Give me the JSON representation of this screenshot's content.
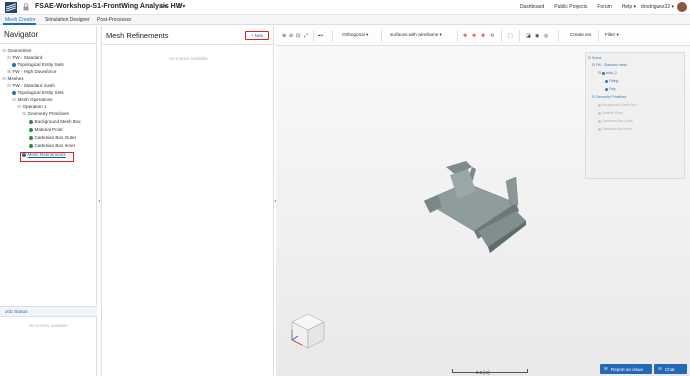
{
  "app": {
    "project_title": "FSAE-Workshop-S1-FrontWing Analysis HW",
    "share_icon": "share-icon",
    "settings_icon": "gear-icon"
  },
  "top_nav": {
    "dashboard": "Dashboard",
    "public_projects": "Public Projects",
    "forum": "Forum",
    "help": "Help ▾",
    "user": "drodriguez32 ▾"
  },
  "tabs": {
    "mesh_creator": "Mesh Creator",
    "simulation_designer": "Simulation Designer",
    "post_processor": "Post-Processor"
  },
  "navigator": {
    "title": "Navigator",
    "tree": {
      "geometries": "Geometries",
      "fw_standard": "FW - Standard",
      "topological_entity_sets_1": "Topological Entity Sets",
      "fw_high_downforce": "FW - High Downforce",
      "meshes": "Meshes",
      "fw_standard_mesh": "FW - Standard mesh",
      "topological_entity_sets_2": "Topological Entity Sets",
      "mesh_operations": "Mesh Operations",
      "operation_1": "Operation 1",
      "geometry_primitives": "Geometry Primitives",
      "background_mesh_box": "Background Mesh Box",
      "material_point": "Material Point",
      "cartesian_box_outer": "Cartesian Box Outer",
      "cartesian_box_inner": "Cartesian Box Inner",
      "mesh_refinements": "Mesh Refinements"
    }
  },
  "job_status": {
    "title": "Job Status",
    "empty": "No entries available"
  },
  "refinements_panel": {
    "title": "Mesh Refinements",
    "new_button": "+ New",
    "empty": "No entries available"
  },
  "viewer_toolbar": {
    "projection": "Orthogonal ▾",
    "render_mode": "surfaces with wireframe ▾",
    "create_set": "Create set",
    "filter": "Filter ▾"
  },
  "scene_tree": {
    "scene": "Scene",
    "mesh": "FW - Standard mesh",
    "solid": "solid_0",
    "fitting": "Fitting",
    "flap": "Flap",
    "primitives": "Geometry Primitives",
    "p1": "Background Mesh Box",
    "p2": "Material Point",
    "p3": "Cartesian Box Outer",
    "p4": "Cartesian Box Inner"
  },
  "scale": {
    "label": "0.5 [m]"
  },
  "buttons": {
    "report_issue": "Report an issue",
    "chat": "Chat"
  },
  "colors": {
    "accent": "#1f6fbf",
    "highlight_box": "#e02020",
    "model_gray": "#8e9b9c",
    "tree_dot_green": "#2e8b3a",
    "tree_dot_blue": "#2f6fa8"
  }
}
